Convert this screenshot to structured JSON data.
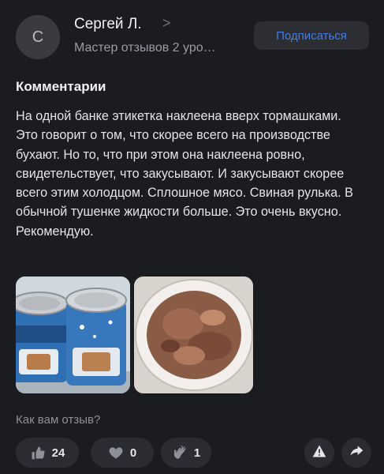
{
  "header": {
    "avatar_letter": "С",
    "author_name": "Сергей Л.",
    "chevron": ">",
    "subtitle": "Мастер отзывов 2 уро…",
    "follow_label": "Подписаться"
  },
  "section_title": "Комментарии",
  "comment_text": "На одной банке этикетка наклеена вверх тормашками. Это говорит о том, что скорее всего на производстве бухают. Но то, что при этом она наклеена ровно, свидетельствует, что закусывают. И закусывают скорее всего этим холодцом. Сплошное мясо. Свиная рулька. В обычной тушенке жидкости больше. Это очень вкусно. Рекомендую.",
  "photos": [
    {
      "name": "canned-meat-photo"
    },
    {
      "name": "meat-plate-photo"
    }
  ],
  "question": "Как вам отзыв?",
  "reactions": {
    "like": {
      "count": "24",
      "icon": "thumbs-up-icon"
    },
    "heart": {
      "count": "0",
      "icon": "heart-icon"
    },
    "clap": {
      "count": "1",
      "icon": "clap-icon"
    }
  },
  "actions": {
    "report_icon": "warning-icon",
    "share_icon": "share-icon"
  },
  "colors": {
    "background": "#1b1c20",
    "accent": "#3e7ee6",
    "pill": "#2b2c31"
  }
}
